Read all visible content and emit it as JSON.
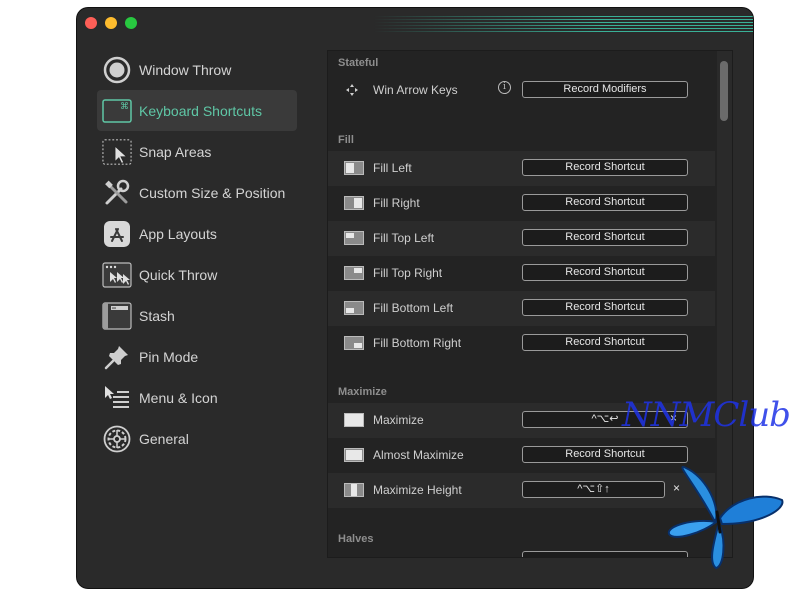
{
  "sidebar": {
    "items": [
      {
        "label": "Window Throw",
        "icon": "target-icon"
      },
      {
        "label": "Keyboard Shortcuts",
        "icon": "command-key-icon"
      },
      {
        "label": "Snap Areas",
        "icon": "snap-cursor-icon"
      },
      {
        "label": "Custom Size & Position",
        "icon": "wrench-icon"
      },
      {
        "label": "App Layouts",
        "icon": "app-store-icon"
      },
      {
        "label": "Quick Throw",
        "icon": "quick-throw-icon"
      },
      {
        "label": "Stash",
        "icon": "stash-icon"
      },
      {
        "label": "Pin Mode",
        "icon": "pin-icon"
      },
      {
        "label": "Menu & Icon",
        "icon": "menu-list-icon"
      },
      {
        "label": "General",
        "icon": "gear-icon"
      }
    ],
    "selected": "Keyboard Shortcuts",
    "accent_color": "#5fc7a6"
  },
  "sections": {
    "stateful": {
      "title": "Stateful",
      "rows": [
        {
          "label": "Win Arrow Keys",
          "button": "Record Modifiers",
          "icon": "arrows-icon"
        }
      ]
    },
    "fill": {
      "title": "Fill",
      "rows": [
        {
          "label": "Fill Left",
          "button": "Record Shortcut"
        },
        {
          "label": "Fill Right",
          "button": "Record Shortcut"
        },
        {
          "label": "Fill Top Left",
          "button": "Record Shortcut"
        },
        {
          "label": "Fill Top Right",
          "button": "Record Shortcut"
        },
        {
          "label": "Fill Bottom Left",
          "button": "Record Shortcut"
        },
        {
          "label": "Fill Bottom Right",
          "button": "Record Shortcut"
        }
      ]
    },
    "maximize": {
      "title": "Maximize",
      "rows": [
        {
          "label": "Maximize",
          "button": "^⌥↩",
          "clear": "×"
        },
        {
          "label": "Almost Maximize",
          "button": "Record Shortcut"
        },
        {
          "label": "Maximize Height",
          "button": "^⌥⇧↑",
          "clear": "×"
        }
      ]
    },
    "halves": {
      "title": "Halves"
    }
  },
  "watermark": "NNMClub"
}
